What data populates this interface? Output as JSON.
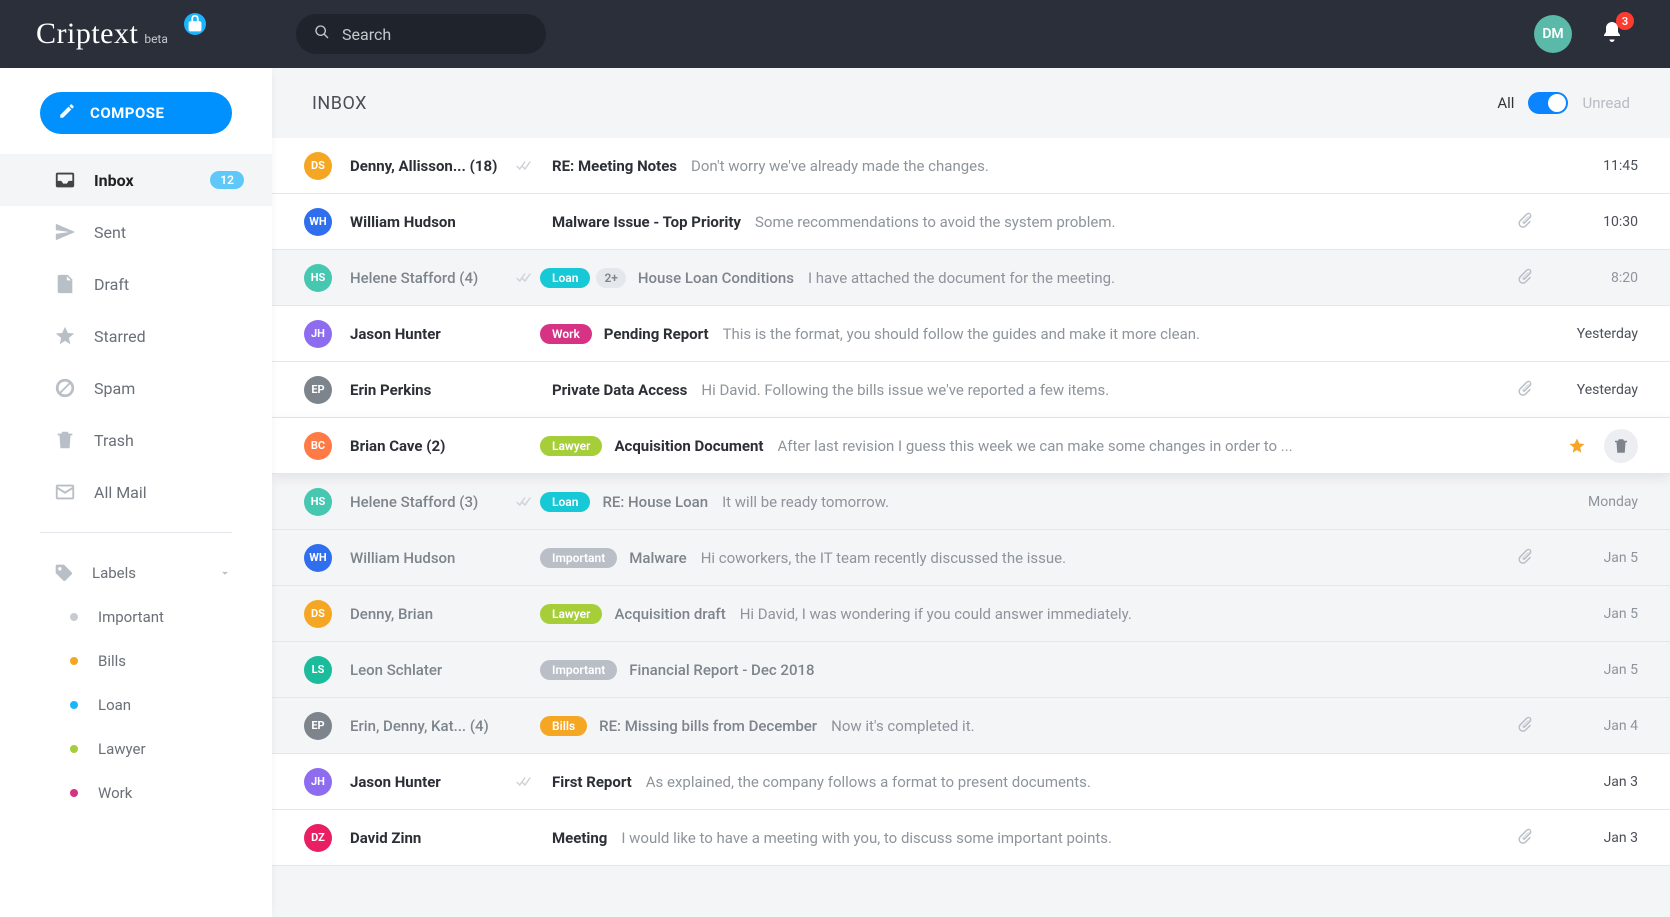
{
  "brand": {
    "name": "Criptext",
    "tag": "beta"
  },
  "search": {
    "placeholder": "Search"
  },
  "user": {
    "initials": "DM",
    "notif_count": "3"
  },
  "compose_label": "COMPOSE",
  "sidebar": {
    "items": [
      {
        "label": "Inbox",
        "badge": "12",
        "active": true
      },
      {
        "label": "Sent"
      },
      {
        "label": "Draft"
      },
      {
        "label": "Starred"
      },
      {
        "label": "Spam"
      },
      {
        "label": "Trash"
      },
      {
        "label": "All Mail"
      }
    ],
    "labels_header": "Labels",
    "labels": [
      {
        "label": "Important",
        "color": "#c8ccd2"
      },
      {
        "label": "Bills",
        "color": "#f5a623"
      },
      {
        "label": "Loan",
        "color": "#19b5fe"
      },
      {
        "label": "Lawyer",
        "color": "#a6ce39"
      },
      {
        "label": "Work",
        "color": "#d63384"
      }
    ]
  },
  "inbox": {
    "title": "INBOX",
    "filter_all": "All",
    "filter_unread": "Unread"
  },
  "tag_colors": {
    "Loan": "#17c8d6",
    "Work": "#d63384",
    "Lawyer": "#a6ce39",
    "Important": "#babfc7",
    "Bills": "#f5a623"
  },
  "emails": [
    {
      "avatar": "DS",
      "avc": "#f5a623",
      "sender": "Denny, Allisson... (18)",
      "check": true,
      "tags": [],
      "subject": "RE: Meeting Notes",
      "preview": "Don't worry we've already made the changes.",
      "attach": false,
      "time": "11:45",
      "read": false,
      "hover": false
    },
    {
      "avatar": "WH",
      "avc": "#2f6fed",
      "sender": "William Hudson",
      "check": false,
      "tags": [],
      "subject": "Malware Issue - Top Priority",
      "preview": "Some recommendations to avoid the system problem.",
      "attach": true,
      "time": "10:30",
      "read": false,
      "hover": false
    },
    {
      "avatar": "HS",
      "avc": "#46c7b0",
      "sender": "Helene Stafford (4)",
      "check": true,
      "tags": [
        "Loan"
      ],
      "count": "2+",
      "subject": "House Loan Conditions",
      "preview": "I have attached the document for the meeting.",
      "attach": true,
      "time": "8:20",
      "read": true,
      "hover": false
    },
    {
      "avatar": "JH",
      "avc": "#8e6cef",
      "sender": "Jason Hunter",
      "check": false,
      "tags": [
        "Work"
      ],
      "subject": "Pending Report",
      "preview": "This is the format, you should follow the guides and make it more clean.",
      "attach": false,
      "time": "Yesterday",
      "read": false,
      "hover": false
    },
    {
      "avatar": "EP",
      "avc": "#7d848c",
      "sender": "Erin Perkins",
      "check": false,
      "tags": [],
      "subject": "Private Data Access",
      "preview": "Hi David. Following the bills issue we've reported a few items.",
      "attach": true,
      "time": "Yesterday",
      "read": false,
      "hover": false
    },
    {
      "avatar": "BC",
      "avc": "#ff7a45",
      "sender": "Brian Cave (2)",
      "check": false,
      "tags": [
        "Lawyer"
      ],
      "subject": "Acquisition Document",
      "preview": "After last revision I guess this week we can make some changes in order to ...",
      "attach": false,
      "time": "",
      "read": false,
      "hover": true
    },
    {
      "avatar": "HS",
      "avc": "#46c7b0",
      "sender": "Helene Stafford (3)",
      "check": true,
      "tags": [
        "Loan"
      ],
      "subject": "RE: House Loan",
      "preview": "It will be ready tomorrow.",
      "attach": false,
      "time": "Monday",
      "read": true,
      "hover": false
    },
    {
      "avatar": "WH",
      "avc": "#2f6fed",
      "sender": "William Hudson",
      "check": false,
      "tags": [
        "Important"
      ],
      "subject": "Malware",
      "preview": "Hi coworkers, the IT team recently discussed the issue.",
      "attach": true,
      "time": "Jan 5",
      "read": true,
      "hover": false
    },
    {
      "avatar": "DS",
      "avc": "#f5a623",
      "sender": "Denny, Brian",
      "check": false,
      "tags": [
        "Lawyer"
      ],
      "subject": "Acquisition draft",
      "preview": "Hi David, I was wondering if you could answer immediately.",
      "attach": false,
      "time": "Jan 5",
      "read": true,
      "hover": false
    },
    {
      "avatar": "LS",
      "avc": "#1abc9c",
      "sender": "Leon Schlater",
      "check": false,
      "tags": [
        "Important"
      ],
      "subject": "Financial Report - Dec 2018",
      "preview": "",
      "attach": false,
      "time": "Jan 5",
      "read": true,
      "hover": false
    },
    {
      "avatar": "EP",
      "avc": "#7d848c",
      "sender": "Erin, Denny, Kat... (4)",
      "check": false,
      "tags": [
        "Bills"
      ],
      "subject": "RE: Missing bills from December",
      "preview": "Now it's completed it.",
      "attach": true,
      "time": "Jan 4",
      "read": true,
      "hover": false
    },
    {
      "avatar": "JH",
      "avc": "#8e6cef",
      "sender": "Jason Hunter",
      "check": true,
      "tags": [],
      "subject": "First Report",
      "preview": "As explained, the company follows a format to present documents.",
      "attach": false,
      "time": "Jan 3",
      "read": false,
      "hover": false
    },
    {
      "avatar": "DZ",
      "avc": "#e91e63",
      "sender": "David Zinn",
      "check": false,
      "tags": [],
      "subject": "Meeting",
      "preview": "I would like to have a meeting with you, to discuss some important points.",
      "attach": true,
      "time": "Jan 3",
      "read": false,
      "hover": false
    }
  ]
}
